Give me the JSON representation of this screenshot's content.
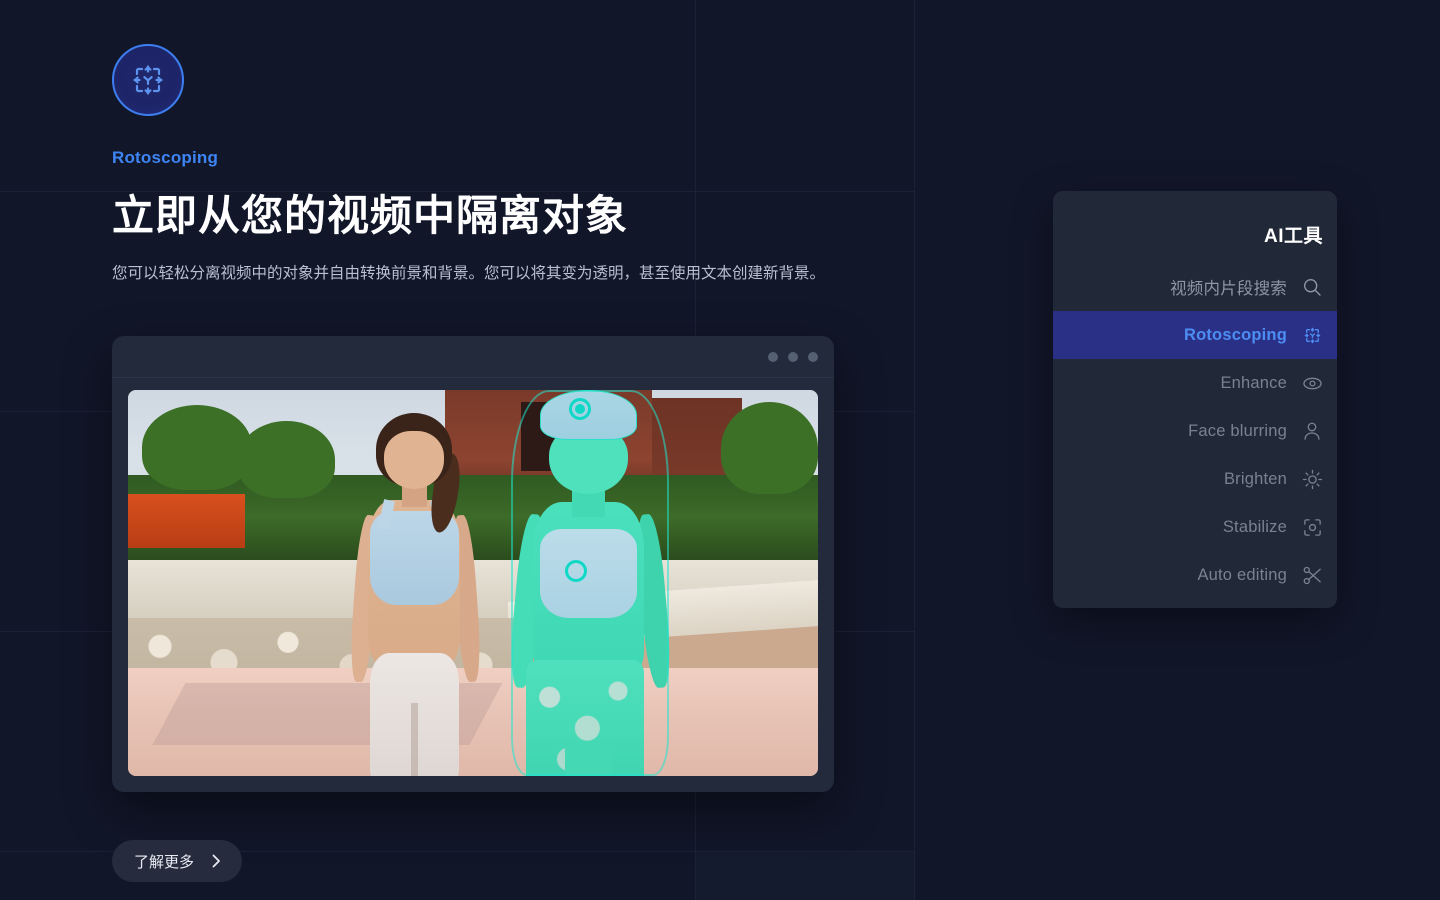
{
  "brand": {
    "logo_icon": "rotoscope-target-icon",
    "eyebrow": "Rotoscoping"
  },
  "hero": {
    "headline": "立即从您的视频中隔离对象",
    "description": "您可以轻松分离视频中的对象并自由转换前景和背景。您可以将其变为透明，甚至使用文本创建新背景。",
    "cta_label": "了解更多",
    "cta_icon": "chevron-right-icon"
  },
  "preview": {
    "window_dots": 3,
    "media_alt": "两位女性在海滨步道行走，右侧人物被青色抠像蒙版选中",
    "mask_color": "#3fe0c0",
    "anchor_color": "#0fd8c6"
  },
  "tools_panel": {
    "title": "AI工具",
    "items": [
      {
        "label": "视频内片段搜索",
        "icon": "search-icon",
        "active": false,
        "kind": "search"
      },
      {
        "label": "Rotoscoping",
        "icon": "rotoscope-target-icon",
        "active": true,
        "kind": "tool"
      },
      {
        "label": "Enhance",
        "icon": "eye-icon",
        "active": false,
        "kind": "tool"
      },
      {
        "label": "Face blurring",
        "icon": "person-icon",
        "active": false,
        "kind": "tool"
      },
      {
        "label": "Brighten",
        "icon": "sun-icon",
        "active": false,
        "kind": "tool"
      },
      {
        "label": "Stabilize",
        "icon": "focus-frame-icon",
        "active": false,
        "kind": "tool"
      },
      {
        "label": "Auto editing",
        "icon": "scissors-icon",
        "active": false,
        "kind": "tool"
      }
    ]
  },
  "theme": {
    "background": "#111629",
    "panel": "#212838",
    "accent_blue": "#3d85f5",
    "active_row": "#2a3086",
    "active_text": "#4d8df3",
    "muted_text": "#79828f",
    "body_text": "#b9c0cf",
    "grid_line": "#1b2236"
  }
}
